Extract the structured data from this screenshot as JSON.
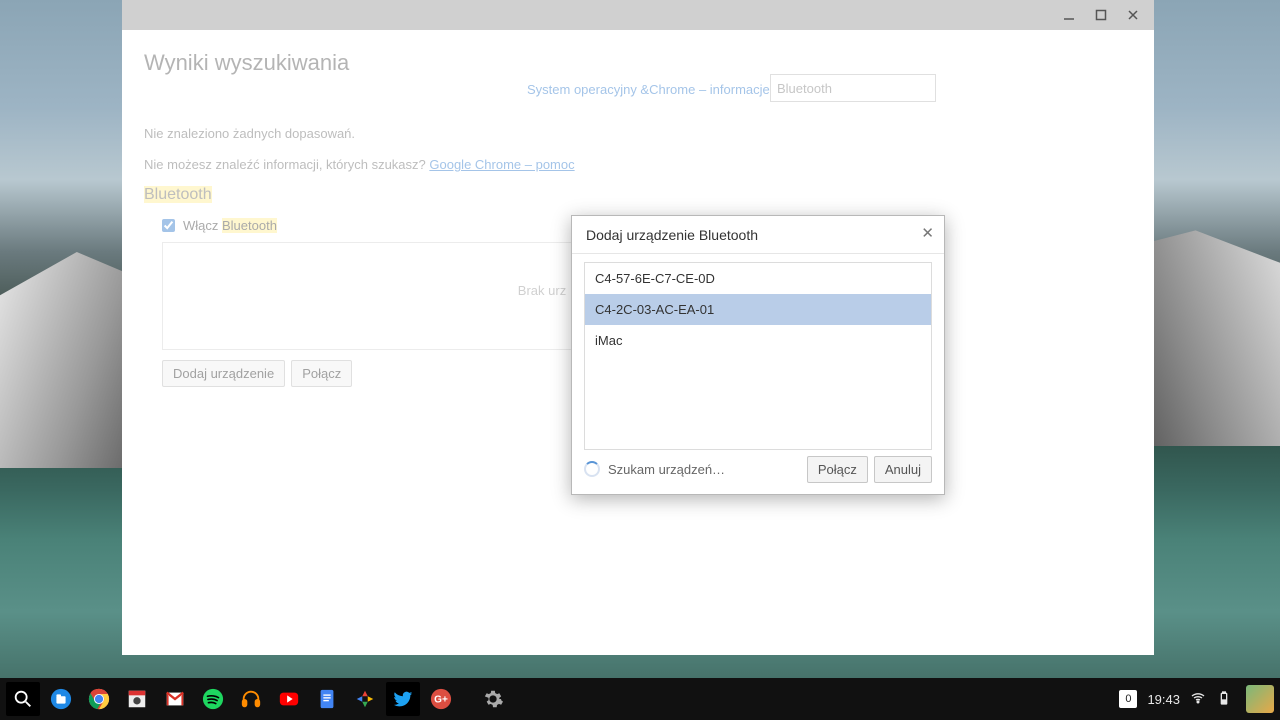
{
  "desktop": {},
  "window": {
    "page_title": "Wyniki wyszukiwania",
    "nav_link": "System operacyjny &Chrome – informacje",
    "search_value": "Bluetooth",
    "no_results": "Nie znaleziono żadnych dopasowań.",
    "help_prefix": "Nie możesz znaleźć informacji, których szukasz? ",
    "help_link": "Google Chrome – pomoc",
    "section_title_pre": "",
    "section_title_hl": "Bluetooth",
    "enable_label_pre": "Włącz ",
    "enable_label_hl": "Bluetooth",
    "no_devices": "Brak urz",
    "add_device_btn": "Dodaj urządzenie",
    "connect_btn": "Połącz"
  },
  "modal": {
    "title": "Dodaj urządzenie Bluetooth",
    "devices": [
      {
        "label": "C4-57-6E-C7-CE-0D",
        "selected": false
      },
      {
        "label": "C4-2C-03-AC-EA-01",
        "selected": true
      },
      {
        "label": "iMac",
        "selected": false
      }
    ],
    "scanning": "Szukam urządzeń…",
    "connect": "Połącz",
    "cancel": "Anuluj"
  },
  "taskbar": {
    "count": "0",
    "clock": "19:43"
  }
}
